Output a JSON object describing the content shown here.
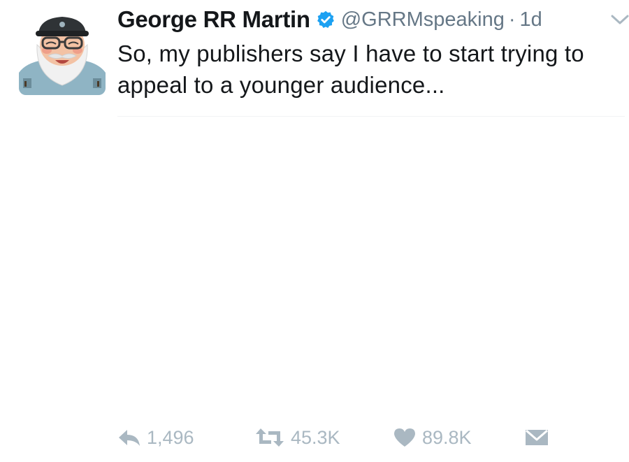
{
  "tweet": {
    "display_name": "George RR Martin",
    "handle": "@GRRMspeaking",
    "separator": "·",
    "time": "1d",
    "text": "So, my publishers say I have to start trying to appeal to a younger audience...",
    "verified": true
  },
  "actions": {
    "reply_count": "1,496",
    "retweet_count": "45.3K",
    "like_count": "89.8K"
  },
  "colors": {
    "text": "#14171a",
    "secondary": "#657786",
    "icon_gray": "#aab8c2",
    "verified_blue": "#1da1f2"
  },
  "icons": {
    "verified": "verified-badge-icon",
    "caret": "chevron-down-icon",
    "reply": "reply-icon",
    "retweet": "retweet-icon",
    "like": "heart-icon",
    "message": "envelope-icon"
  }
}
